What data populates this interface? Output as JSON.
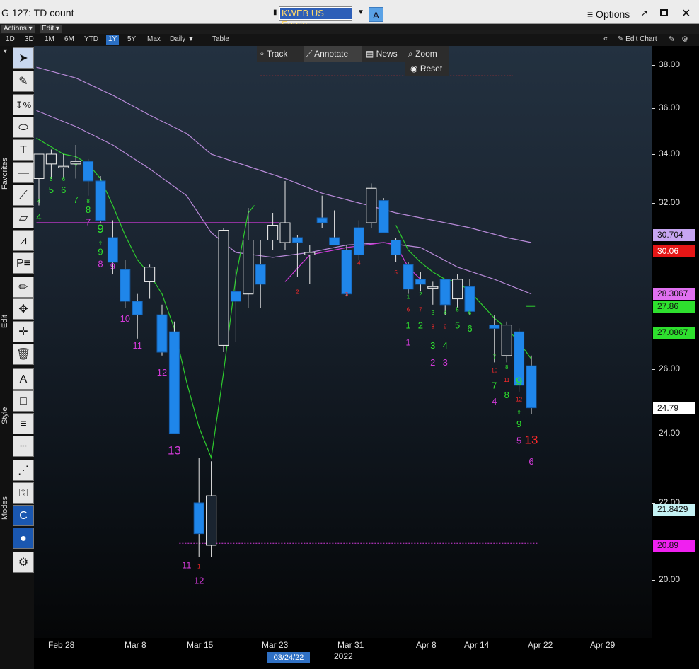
{
  "window": {
    "title": "G 127: TD count",
    "ticker": "KWEB US Equity",
    "ticker_badge": "A",
    "options_label": "≡ Options",
    "popout_icon": "↗",
    "close_icon": "✕"
  },
  "menus": {
    "actions": "Actions ▾",
    "edit": "Edit ▾"
  },
  "ranges": [
    "1D",
    "3D",
    "1M",
    "6M",
    "YTD",
    "1Y",
    "5Y",
    "Max"
  ],
  "active_range": "1Y",
  "frequency": "Daily ▼",
  "table_label": "Table",
  "edit_chart": "Edit Chart",
  "chart_menu": {
    "track": "Track",
    "annotate": "Annotate",
    "news": "News",
    "zoom": "Zoom",
    "reset": "Reset"
  },
  "side_labels": {
    "favorites": "Favorites",
    "edit": "Edit",
    "style": "Style",
    "modes": "Modes"
  },
  "colors": {
    "candle_up": "#ffffff",
    "candle_down": "#1f86ea",
    "td_green": "#2ee02e",
    "td_magenta": "#d23ad8",
    "td_red": "#ff2a2a",
    "ma_violet": "#b88ad8",
    "ma_green": "#2ecc2e",
    "line_magenta": "#d13bdc",
    "lvl_red": "#e03030"
  },
  "chart_data": {
    "type": "candlestick",
    "x_ticks": [
      "Feb 28",
      "Mar 8",
      "Mar 15",
      "Mar 23",
      "Mar 31",
      "Apr 8",
      "Apr 14",
      "Apr 22",
      "Apr 29"
    ],
    "x_selected": "03/24/22",
    "x_year": "2022",
    "y_ticks": [
      "38.00",
      "36.00",
      "34.00",
      "32.00",
      "26.00",
      "24.00",
      "22.00",
      "20.00"
    ],
    "ylim": [
      18.5,
      38.5
    ],
    "price_labels": [
      {
        "text": "30.704",
        "value": 30.704,
        "color": "#c7a6f2"
      },
      {
        "text": "30.06",
        "value": 30.06,
        "color": "#e51616"
      },
      {
        "text": "28.3067",
        "value": 28.3067,
        "color": "#e070f0"
      },
      {
        "text": "27.86",
        "value": 27.86,
        "color": "#2ee02e"
      },
      {
        "text": "27.0867",
        "value": 27.0867,
        "color": "#2ee02e"
      },
      {
        "text": "24.79",
        "value": 24.79,
        "color": "#ffffff"
      },
      {
        "text": "21.8429",
        "value": 21.8429,
        "color": "#c5f2f4"
      },
      {
        "text": "20.89",
        "value": 20.89,
        "color": "#f020f0"
      }
    ],
    "candles": [
      {
        "d": 0,
        "o": 33.0,
        "h": 34.0,
        "l": 31.9,
        "c": 34.0
      },
      {
        "d": 1,
        "o": 33.6,
        "h": 34.2,
        "l": 33.0,
        "c": 34.0
      },
      {
        "d": 2,
        "o": 33.5,
        "h": 34.0,
        "l": 33.0,
        "c": 33.5
      },
      {
        "d": 3,
        "o": 33.6,
        "h": 34.4,
        "l": 33.0,
        "c": 33.7
      },
      {
        "d": 4,
        "o": 33.7,
        "h": 33.8,
        "l": 32.3,
        "c": 32.9
      },
      {
        "d": 5,
        "o": 32.9,
        "h": 33.1,
        "l": 31.2,
        "c": 31.3
      },
      {
        "d": 6,
        "o": 30.6,
        "h": 31.3,
        "l": 29.1,
        "c": 29.6
      },
      {
        "d": 7,
        "o": 29.3,
        "h": 29.7,
        "l": 27.8,
        "c": 28.0
      },
      {
        "d": 8,
        "o": 28.0,
        "h": 28.3,
        "l": 26.9,
        "c": 27.6
      },
      {
        "d": 9,
        "o": 28.8,
        "h": 29.5,
        "l": 28.1,
        "c": 29.4
      },
      {
        "d": 10,
        "o": 27.6,
        "h": 27.9,
        "l": 26.4,
        "c": 26.5
      },
      {
        "d": 11,
        "o": 27.1,
        "h": 27.4,
        "l": 24.0,
        "c": 24.0
      },
      {
        "d": 13,
        "o": 22.0,
        "h": 23.3,
        "l": 20.6,
        "c": 21.2
      },
      {
        "d": 14,
        "o": 20.9,
        "h": 23.2,
        "l": 20.6,
        "c": 22.2
      },
      {
        "d": 15,
        "o": 26.7,
        "h": 31.0,
        "l": 26.5,
        "c": 30.9
      },
      {
        "d": 16,
        "o": 28.4,
        "h": 29.3,
        "l": 26.8,
        "c": 28.0
      },
      {
        "d": 17,
        "o": 28.3,
        "h": 31.8,
        "l": 27.8,
        "c": 30.5
      },
      {
        "d": 18,
        "o": 29.5,
        "h": 30.5,
        "l": 27.8,
        "c": 28.7
      },
      {
        "d": 19,
        "o": 30.5,
        "h": 31.6,
        "l": 30.1,
        "c": 31.1
      },
      {
        "d": 20,
        "o": 30.4,
        "h": 32.9,
        "l": 30.1,
        "c": 31.2
      },
      {
        "d": 21,
        "o": 30.6,
        "h": 30.7,
        "l": 29.0,
        "c": 30.4
      },
      {
        "d": 22,
        "o": 29.9,
        "h": 30.3,
        "l": 28.7,
        "c": 30.0
      },
      {
        "d": 23,
        "o": 31.4,
        "h": 32.3,
        "l": 31.0,
        "c": 31.2
      },
      {
        "d": 24,
        "o": 30.6,
        "h": 31.7,
        "l": 30.3,
        "c": 30.3
      },
      {
        "d": 25,
        "o": 30.1,
        "h": 30.3,
        "l": 28.2,
        "c": 28.3
      },
      {
        "d": 26,
        "o": 31.0,
        "h": 31.3,
        "l": 29.7,
        "c": 29.9
      },
      {
        "d": 27,
        "o": 31.2,
        "h": 32.8,
        "l": 31.0,
        "c": 32.6
      },
      {
        "d": 28,
        "o": 32.1,
        "h": 32.2,
        "l": 30.8,
        "c": 30.8
      },
      {
        "d": 29,
        "o": 30.5,
        "h": 30.6,
        "l": 29.6,
        "c": 29.9
      },
      {
        "d": 30,
        "o": 29.5,
        "h": 29.6,
        "l": 28.3,
        "c": 28.5
      },
      {
        "d": 31,
        "o": 28.9,
        "h": 29.2,
        "l": 28.4,
        "c": 28.7
      },
      {
        "d": 32,
        "o": 28.6,
        "h": 28.8,
        "l": 27.9,
        "c": 28.6
      },
      {
        "d": 33,
        "o": 28.9,
        "h": 28.9,
        "l": 27.6,
        "c": 27.9
      },
      {
        "d": 34,
        "o": 28.1,
        "h": 29.1,
        "l": 27.8,
        "c": 28.9
      },
      {
        "d": 35,
        "o": 28.6,
        "h": 28.9,
        "l": 27.6,
        "c": 27.7
      },
      {
        "d": 37,
        "o": 27.3,
        "h": 27.6,
        "l": 26.2,
        "c": 27.2
      },
      {
        "d": 38,
        "o": 26.4,
        "h": 27.4,
        "l": 26.2,
        "c": 27.3
      },
      {
        "d": 39,
        "o": 27.1,
        "h": 27.2,
        "l": 25.3,
        "c": 25.5
      },
      {
        "d": 40,
        "o": 26.1,
        "h": 26.4,
        "l": 24.6,
        "c": 24.8
      }
    ],
    "td_labels": [
      {
        "d": 0,
        "t": "4",
        "v": 32.0,
        "c": "green",
        "s": "small"
      },
      {
        "d": 0,
        "t": "4",
        "v": 31.3,
        "c": "green",
        "s": "big"
      },
      {
        "d": 1,
        "t": "5",
        "v": 32.9,
        "c": "green",
        "s": "small"
      },
      {
        "d": 1,
        "t": "5",
        "v": 32.4,
        "c": "green",
        "s": "big"
      },
      {
        "d": 2,
        "t": "6",
        "v": 32.9,
        "c": "green",
        "s": "small"
      },
      {
        "d": 2,
        "t": "6",
        "v": 32.4,
        "c": "green",
        "s": "big"
      },
      {
        "d": 3,
        "t": "7",
        "v": 33.4,
        "c": "green",
        "s": "small"
      },
      {
        "d": 3,
        "t": "7",
        "v": 32.0,
        "c": "green",
        "s": "big"
      },
      {
        "d": 4,
        "t": "8",
        "v": 32.0,
        "c": "green",
        "s": "small"
      },
      {
        "d": 4,
        "t": "8",
        "v": 31.6,
        "c": "green",
        "s": "big"
      },
      {
        "d": 4,
        "t": "7",
        "v": 31.1,
        "c": "magenta",
        "s": "big"
      },
      {
        "d": 5,
        "t": "9",
        "v": 30.8,
        "c": "green",
        "s": "huge"
      },
      {
        "d": 5,
        "t": "⇧",
        "v": 30.3,
        "c": "green",
        "s": "small"
      },
      {
        "d": 5,
        "t": "9",
        "v": 29.9,
        "c": "green",
        "s": "big"
      },
      {
        "d": 5,
        "t": "8",
        "v": 29.4,
        "c": "magenta",
        "s": "big"
      },
      {
        "d": 6,
        "t": "9",
        "v": 29.3,
        "c": "magenta",
        "s": "big"
      },
      {
        "d": 7,
        "t": "10",
        "v": 27.4,
        "c": "magenta",
        "s": "big"
      },
      {
        "d": 8,
        "t": "11",
        "v": 26.6,
        "c": "magenta",
        "s": "big"
      },
      {
        "d": 10,
        "t": "12",
        "v": 25.8,
        "c": "magenta",
        "s": "big"
      },
      {
        "d": 11,
        "t": "13",
        "v": 23.4,
        "c": "magenta",
        "s": "huge"
      },
      {
        "d": 12,
        "t": "11",
        "v": 20.3,
        "c": "magenta",
        "s": "big"
      },
      {
        "d": 13,
        "t": "1",
        "v": 20.3,
        "c": "red",
        "s": "small"
      },
      {
        "d": 13,
        "t": "12",
        "v": 19.9,
        "c": "magenta",
        "s": "big"
      },
      {
        "d": 21,
        "t": "2",
        "v": 28.3,
        "c": "red",
        "s": "small"
      },
      {
        "d": 25,
        "t": "3",
        "v": 28.2,
        "c": "red",
        "s": "small"
      },
      {
        "d": 26,
        "t": "4",
        "v": 29.5,
        "c": "red",
        "s": "small"
      },
      {
        "d": 29,
        "t": "5",
        "v": 29.1,
        "c": "red",
        "s": "small"
      },
      {
        "d": 30,
        "t": "1",
        "v": 28.1,
        "c": "green",
        "s": "small"
      },
      {
        "d": 30,
        "t": "6",
        "v": 27.7,
        "c": "red",
        "s": "small"
      },
      {
        "d": 30,
        "t": "1",
        "v": 27.2,
        "c": "green",
        "s": "big"
      },
      {
        "d": 30,
        "t": "1",
        "v": 26.7,
        "c": "magenta",
        "s": "big"
      },
      {
        "d": 31,
        "t": "2",
        "v": 28.2,
        "c": "green",
        "s": "small"
      },
      {
        "d": 31,
        "t": "7",
        "v": 27.7,
        "c": "red",
        "s": "small"
      },
      {
        "d": 31,
        "t": "2",
        "v": 27.2,
        "c": "green",
        "s": "big"
      },
      {
        "d": 32,
        "t": "3",
        "v": 27.6,
        "c": "green",
        "s": "small"
      },
      {
        "d": 32,
        "t": "8",
        "v": 27.2,
        "c": "red",
        "s": "small"
      },
      {
        "d": 32,
        "t": "3",
        "v": 26.6,
        "c": "green",
        "s": "big"
      },
      {
        "d": 32,
        "t": "2",
        "v": 26.1,
        "c": "magenta",
        "s": "big"
      },
      {
        "d": 33,
        "t": "4",
        "v": 27.6,
        "c": "green",
        "s": "small"
      },
      {
        "d": 33,
        "t": "9",
        "v": 27.2,
        "c": "red",
        "s": "small"
      },
      {
        "d": 33,
        "t": "4",
        "v": 26.6,
        "c": "green",
        "s": "big"
      },
      {
        "d": 33,
        "t": "3",
        "v": 26.1,
        "c": "magenta",
        "s": "big"
      },
      {
        "d": 34,
        "t": "5",
        "v": 27.7,
        "c": "green",
        "s": "small"
      },
      {
        "d": 34,
        "t": "5",
        "v": 27.2,
        "c": "green",
        "s": "big"
      },
      {
        "d": 35,
        "t": "6",
        "v": 27.6,
        "c": "green",
        "s": "small"
      },
      {
        "d": 35,
        "t": "6",
        "v": 27.1,
        "c": "green",
        "s": "big"
      },
      {
        "d": 37,
        "t": "7",
        "v": 26.3,
        "c": "green",
        "s": "small"
      },
      {
        "d": 37,
        "t": "10",
        "v": 25.9,
        "c": "red",
        "s": "small"
      },
      {
        "d": 37,
        "t": "7",
        "v": 25.4,
        "c": "green",
        "s": "big"
      },
      {
        "d": 37,
        "t": "4",
        "v": 24.9,
        "c": "magenta",
        "s": "big"
      },
      {
        "d": 38,
        "t": "8",
        "v": 26.0,
        "c": "green",
        "s": "small"
      },
      {
        "d": 38,
        "t": "11",
        "v": 25.6,
        "c": "red",
        "s": "small"
      },
      {
        "d": 38,
        "t": "8",
        "v": 25.1,
        "c": "green",
        "s": "big"
      },
      {
        "d": 39,
        "t": "9",
        "v": 25.5,
        "c": "green",
        "s": "huge"
      },
      {
        "d": 39,
        "t": "12",
        "v": 25.0,
        "c": "red",
        "s": "small"
      },
      {
        "d": 39,
        "t": "⇧",
        "v": 24.6,
        "c": "green",
        "s": "small"
      },
      {
        "d": 39,
        "t": "9",
        "v": 24.2,
        "c": "green",
        "s": "big"
      },
      {
        "d": 39,
        "t": "5",
        "v": 23.7,
        "c": "magenta",
        "s": "big"
      },
      {
        "d": 40,
        "t": "13",
        "v": 23.7,
        "c": "red",
        "s": "huge"
      },
      {
        "d": 40,
        "t": "6",
        "v": 23.1,
        "c": "magenta",
        "s": "big"
      }
    ],
    "ma_upper": [
      [
        -0.2,
        37.9
      ],
      [
        3,
        37.4
      ],
      [
        6,
        36.6
      ],
      [
        9,
        35.7
      ],
      [
        12,
        34.9
      ],
      [
        14,
        34.0
      ],
      [
        17,
        33.5
      ],
      [
        20,
        33.0
      ],
      [
        23,
        32.4
      ],
      [
        26,
        32.0
      ],
      [
        29,
        31.6
      ],
      [
        32,
        31.3
      ],
      [
        35,
        31.0
      ],
      [
        38,
        30.6
      ],
      [
        40,
        30.4
      ]
    ],
    "ma_middle": [
      [
        -0.2,
        35.9
      ],
      [
        3,
        35.2
      ],
      [
        6,
        34.4
      ],
      [
        9,
        33.4
      ],
      [
        12,
        32.3
      ],
      [
        14,
        30.8
      ],
      [
        16,
        30.0
      ],
      [
        19,
        29.8
      ],
      [
        22,
        30.0
      ],
      [
        25,
        30.3
      ],
      [
        28,
        30.4
      ],
      [
        31,
        30.2
      ],
      [
        34,
        29.4
      ],
      [
        37,
        28.9
      ],
      [
        40,
        28.3
      ]
    ],
    "ma_green": [
      [
        -0.2,
        34.7
      ],
      [
        2,
        34.0
      ],
      [
        3,
        33.9
      ],
      [
        4,
        33.6
      ],
      [
        5,
        33.0
      ],
      [
        6,
        31.9
      ],
      [
        7,
        30.7
      ],
      [
        8,
        29.7
      ],
      [
        9,
        29.1
      ],
      [
        10,
        28.3
      ],
      [
        11,
        27.2
      ],
      [
        12,
        25.6
      ],
      [
        13,
        24.2
      ],
      [
        14,
        23.3
      ],
      [
        15,
        25.9
      ],
      [
        16,
        29.0
      ],
      [
        17,
        31.6
      ],
      [
        17.5,
        31.9
      ]
    ],
    "ma_green2": [
      [
        29,
        31.1
      ],
      [
        30,
        30.1
      ],
      [
        31,
        29.6
      ],
      [
        32,
        29.2
      ],
      [
        33,
        28.9
      ],
      [
        34,
        28.8
      ],
      [
        35,
        28.4
      ],
      [
        36,
        27.9
      ],
      [
        37,
        27.5
      ],
      [
        38,
        27.2
      ],
      [
        39,
        26.8
      ],
      [
        40,
        26.3
      ]
    ],
    "mag_line": [
      [
        20,
        28.8
      ],
      [
        22,
        29.9
      ],
      [
        25,
        30.2
      ],
      [
        28,
        30.4
      ],
      [
        29,
        30.3
      ],
      [
        30,
        29.4
      ],
      [
        31,
        28.9
      ]
    ],
    "levels": [
      {
        "v": 37.5,
        "x0": 18,
        "x1": 38.5,
        "color": "red"
      },
      {
        "v": 31.2,
        "x0": -0.2,
        "x1": 19.5,
        "color": "magenta",
        "dash": false
      },
      {
        "v": 29.9,
        "x0": -0.2,
        "x1": 12,
        "color": "magenta"
      },
      {
        "v": 30.1,
        "x0": 31,
        "x1": 40.5,
        "color": "red"
      },
      {
        "v": 20.95,
        "x0": 11.4,
        "x1": 40.5,
        "color": "magenta"
      }
    ]
  }
}
